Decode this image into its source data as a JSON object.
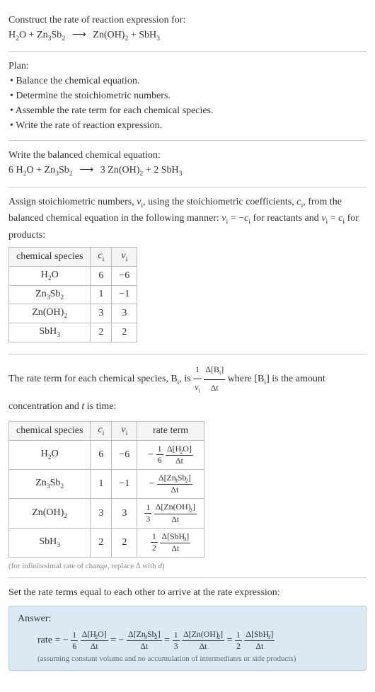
{
  "title": "Construct the rate of reaction expression for:",
  "eq_unbal_lhs1": "H",
  "eq_unbal_lhs1s": "2",
  "eq_unbal_lhs1b": "O + Zn",
  "eq_unbal_lhs2s": "3",
  "eq_unbal_lhs2b": "Sb",
  "eq_unbal_lhs3s": "2",
  "arrow": "⟶",
  "eq_unbal_rhs1": "Zn(OH)",
  "eq_unbal_rhs1s": "2",
  "eq_unbal_rhs1b": " + SbH",
  "eq_unbal_rhs2s": "3",
  "plan_label": "Plan:",
  "plan_1": "• Balance the chemical equation.",
  "plan_2": "• Determine the stoichiometric numbers.",
  "plan_3": "• Assemble the rate term for each chemical species.",
  "plan_4": "• Write the rate of reaction expression.",
  "bal_label": "Write the balanced chemical equation:",
  "bal_lhs_pre": "6 H",
  "bal_lhs_2": "2",
  "bal_lhs_mid": "O + Zn",
  "bal_lhs_3": "3",
  "bal_lhs_sb": "Sb",
  "bal_lhs_sb2": "2",
  "bal_rhs_pre": "3 Zn(OH)",
  "bal_rhs_2": "2",
  "bal_rhs_mid": " + 2 SbH",
  "bal_rhs_3": "3",
  "assign_text_a": "Assign stoichiometric numbers, ",
  "nu": "ν",
  "nu_i": "i",
  "assign_text_b": ", using the stoichiometric coefficients, ",
  "c": "c",
  "c_i": "i",
  "assign_text_c": ", from the balanced chemical equation in the following manner: ",
  "eq_reac": " = −",
  "assign_text_d": " for reactants and ",
  "eq_prod": " = ",
  "assign_text_e": " for products:",
  "th_species": "chemical species",
  "th_ci": "c",
  "th_ci_i": "i",
  "th_nui": "ν",
  "th_nui_i": "i",
  "r1_sp_a": "H",
  "r1_sp_s": "2",
  "r1_sp_b": "O",
  "r1_c": "6",
  "r1_nu": "−6",
  "r2_sp_a": "Zn",
  "r2_sp_s1": "3",
  "r2_sp_b": "Sb",
  "r2_sp_s2": "2",
  "r2_c": "1",
  "r2_nu": "−1",
  "r3_sp_a": "Zn(OH)",
  "r3_sp_s": "2",
  "r3_c": "3",
  "r3_nu": "3",
  "r4_sp_a": "SbH",
  "r4_sp_s": "3",
  "r4_c": "2",
  "r4_nu": "2",
  "rate_term_a": "The rate term for each chemical species, B",
  "rate_term_b": ", is ",
  "one": "1",
  "nu_i_full": "ν",
  "nu_i_sub": "i",
  "dbi_num_a": "Δ[B",
  "dbi_num_b": "]",
  "dbi_den": "Δt",
  "rate_term_c": " where [B",
  "rate_term_d": "] is the amount concentration and ",
  "t_var": "t",
  "rate_term_e": " is time:",
  "th_rate": "rate term",
  "rt1_sign": "−",
  "rt1_num": "1",
  "rt1_den": "6",
  "rt1_dnum_a": "Δ[H",
  "rt1_dnum_s": "2",
  "rt1_dnum_b": "O]",
  "rt1_dden": "Δt",
  "rt2_sign": "−",
  "rt2_dnum_a": "Δ[Zn",
  "rt2_dnum_s1": "3",
  "rt2_dnum_b": "Sb",
  "rt2_dnum_s2": "2",
  "rt2_dnum_c": "]",
  "rt2_dden": "Δt",
  "rt3_num": "1",
  "rt3_den": "3",
  "rt3_dnum_a": "Δ[Zn(OH)",
  "rt3_dnum_s": "2",
  "rt3_dnum_b": "]",
  "rt3_dden": "Δt",
  "rt4_num": "1",
  "rt4_den": "2",
  "rt4_dnum_a": "Δ[SbH",
  "rt4_dnum_s": "3",
  "rt4_dnum_b": "]",
  "rt4_dden": "Δt",
  "inf_note_a": "(for infinitesimal rate of change, replace Δ with ",
  "d_var": "d",
  "inf_note_b": ")",
  "set_text": "Set the rate terms equal to each other to arrive at the rate expression:",
  "answer_label": "Answer:",
  "rate_eq": "rate = ",
  "minus": "−",
  "equals": " = ",
  "ans_note": "(assuming constant volume and no accumulation of intermediates or side products)"
}
